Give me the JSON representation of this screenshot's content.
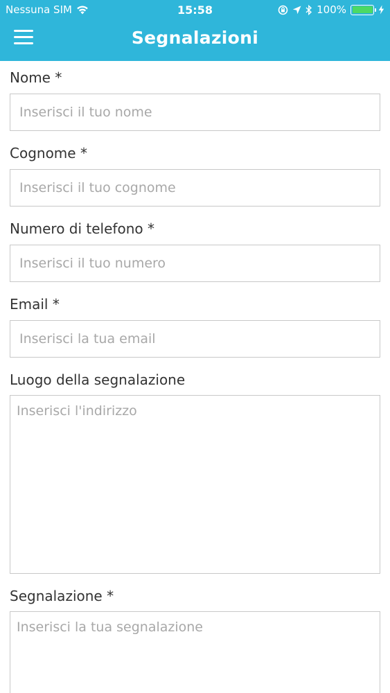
{
  "status_bar": {
    "carrier": "Nessuna SIM",
    "time": "15:58",
    "battery_text": "100%"
  },
  "nav": {
    "title": "Segnalazioni"
  },
  "form": {
    "nome": {
      "label": "Nome *",
      "placeholder": "Inserisci il tuo nome",
      "value": ""
    },
    "cognome": {
      "label": "Cognome *",
      "placeholder": "Inserisci il tuo cognome",
      "value": ""
    },
    "telefono": {
      "label": "Numero di telefono *",
      "placeholder": "Inserisci il tuo numero",
      "value": ""
    },
    "email": {
      "label": "Email *",
      "placeholder": "Inserisci la tua email",
      "value": ""
    },
    "luogo": {
      "label": "Luogo della segnalazione",
      "placeholder": "Inserisci l'indirizzo",
      "value": ""
    },
    "segnalazione": {
      "label": "Segnalazione *",
      "placeholder": "Inserisci la tua segnalazione",
      "value": ""
    }
  },
  "colors": {
    "header_bg": "#2fb6da",
    "battery_fill": "#4cd964",
    "input_border": "#c8c8c8",
    "placeholder": "#a8a8a8"
  }
}
